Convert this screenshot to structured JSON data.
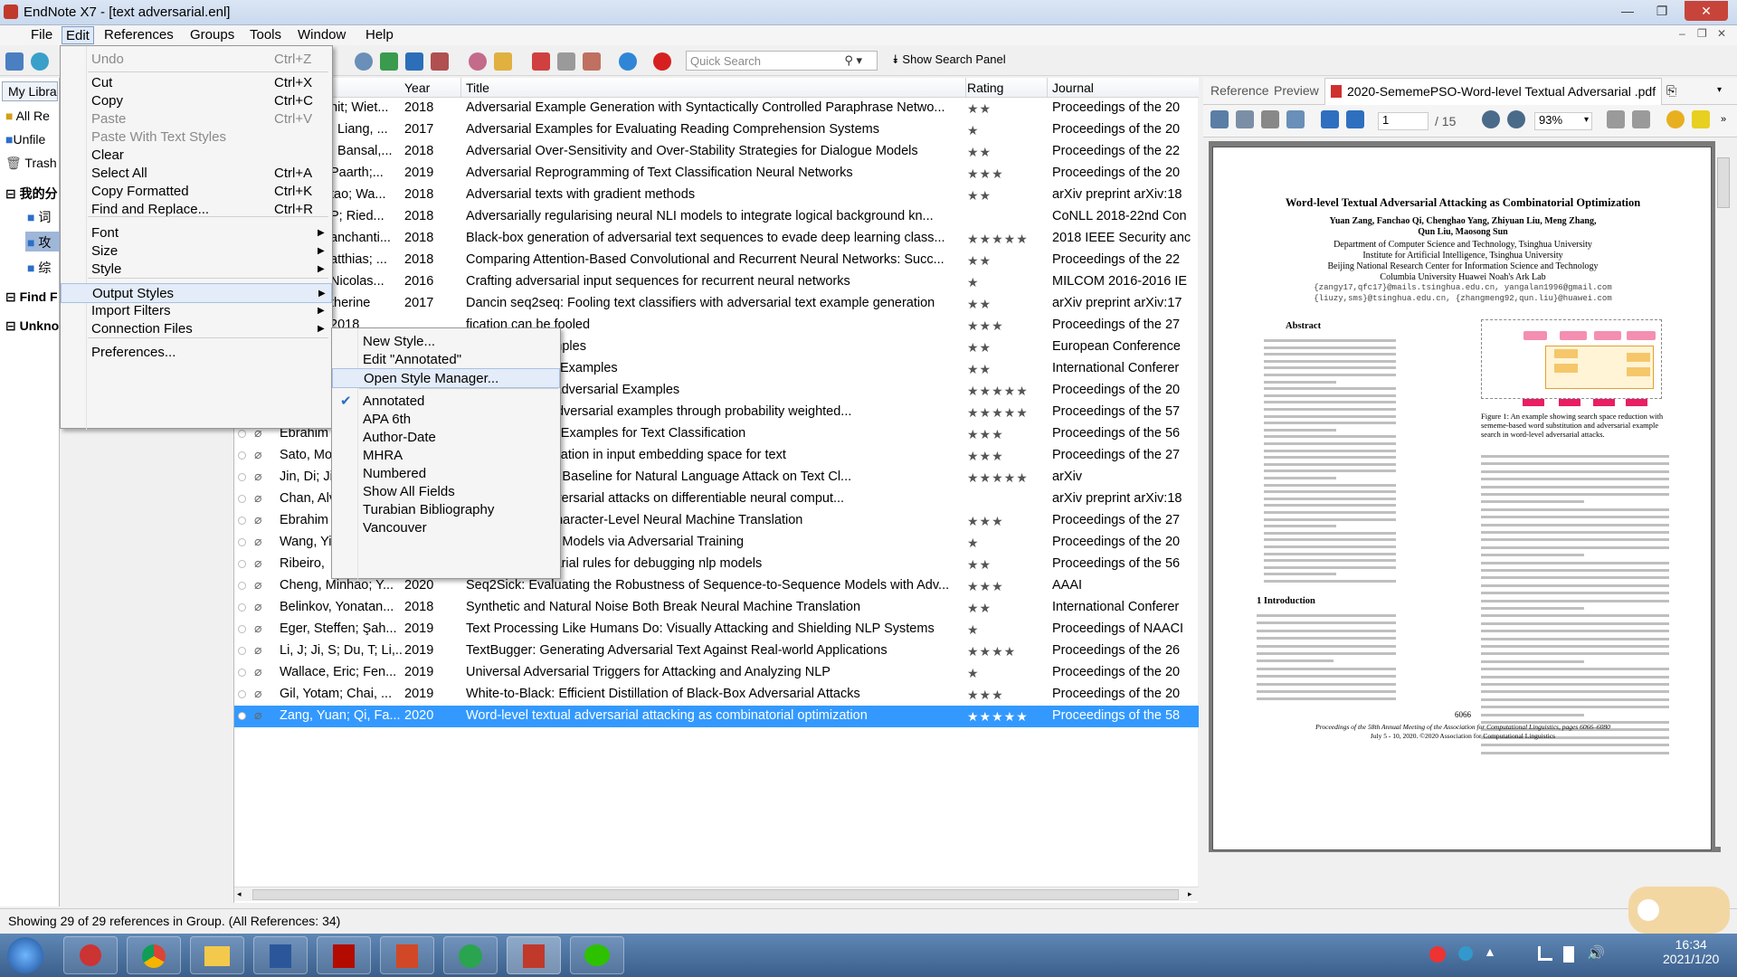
{
  "window": {
    "title": "EndNote X7 - [text adversarial.enl]"
  },
  "menubar": [
    "File",
    "Edit",
    "References",
    "Groups",
    "Tools",
    "Window",
    "Help"
  ],
  "quick_search": {
    "placeholder": "Quick Search",
    "show_panel": "Show Search Panel"
  },
  "groups": {
    "my_library": "My Libra",
    "all_refs": "All Re",
    "unfiled": "Unfile",
    "trash": "Trash",
    "group_set": "我的分",
    "sub1": "词",
    "sub2": "攻",
    "sub3": "综",
    "find": "Find F",
    "unknown": "Unkno"
  },
  "columns": {
    "year": "Year",
    "title": "Title",
    "rating": "Rating",
    "journal": "Journal"
  },
  "references": [
    {
      "author": "",
      "year": "2018",
      "title": "Adversarial Example Generation with Syntactically Controlled Paraphrase Netwo...",
      "rating": "★★",
      "journal": "Proceedings of the 20"
    },
    {
      "author": "",
      "year": "2017",
      "title": "Adversarial Examples for Evaluating Reading Comprehension Systems",
      "rating": "★",
      "journal": "Proceedings of the 20"
    },
    {
      "author": "",
      "year": "2018",
      "title": "Adversarial Over-Sensitivity and Over-Stability Strategies for Dialogue Models",
      "rating": "★★",
      "journal": "Proceedings of the 22"
    },
    {
      "author": "",
      "year": "2019",
      "title": "Adversarial Reprogramming of Text Classification Neural Networks",
      "rating": "★★★",
      "journal": "Proceedings of the 20"
    },
    {
      "author": "",
      "year": "2018",
      "title": "Adversarial texts with gradient methods",
      "rating": "★★",
      "journal": "arXiv preprint arXiv:18"
    },
    {
      "author": "",
      "year": "2018",
      "title": "Adversarially regularising neural NLI models to integrate logical background kn...",
      "rating": "",
      "journal": "CoNLL 2018-22nd Con"
    },
    {
      "author": "",
      "year": "2018",
      "title": "Black-box generation of adversarial text sequences to evade deep learning class...",
      "rating": "★★★★★",
      "journal": "2018 IEEE Security anc"
    },
    {
      "author": "",
      "year": "2018",
      "title": "Comparing Attention-Based Convolutional and Recurrent Neural Networks: Succ...",
      "rating": "★★",
      "journal": "Proceedings of the 22"
    },
    {
      "author": "",
      "year": "2016",
      "title": "Crafting adversarial input sequences for recurrent neural networks",
      "rating": "★",
      "journal": "MILCOM 2016-2016 IE"
    },
    {
      "author": "",
      "year": "2017",
      "title": "Dancin seq2seq: Fooling text classifiers with adversarial text example generation",
      "rating": "★★",
      "journal": "arXiv preprint arXiv:17"
    },
    {
      "author": "",
      "year": "",
      "title": "fication can be fooled",
      "rating": "★★★",
      "journal": "Proceedings of the 27"
    },
    {
      "author": "",
      "year": "",
      "title": "ersarial text samples",
      "rating": "★★",
      "journal": "European Conference"
    },
    {
      "author": "",
      "year": "",
      "title": "ural Adversarial Examples",
      "rating": "★★",
      "journal": "International Conferer"
    },
    {
      "author": "",
      "year": "",
      "title": "ural Language Adversarial Examples",
      "rating": "★★★★★",
      "journal": "Proceedings of the 20"
    },
    {
      "author": "",
      "year": "",
      "title": "ural language adversarial examples through probability weighted...",
      "rating": "★★★★★",
      "journal": "Proceedings of the 57"
    },
    {
      "author": "Ebrahim",
      "year": "",
      "title": "Box Adversarial Examples for Text Classification",
      "rating": "★★★",
      "journal": "Proceedings of the 56"
    },
    {
      "author": "Sato, Mo",
      "year": "",
      "title": "versarial perturbation in input embedding space for text",
      "rating": "★★★",
      "journal": "Proceedings of the 27"
    },
    {
      "author": "Jin, Di; Ji",
      "year": "",
      "title": "obust? A Strong Baseline for Natural Language Attack on Text Cl...",
      "rating": "★★★★★",
      "journal": "arXiv"
    },
    {
      "author": "Chan, Alv",
      "year": "",
      "title": "lation based adversarial attacks on differentiable neural comput...",
      "rating": "",
      "journal": "arXiv preprint arXiv:18"
    },
    {
      "author": "Ebrahim",
      "year": "",
      "title": "Examples for Character-Level Neural Machine Translation",
      "rating": "★★★",
      "journal": "Proceedings of the 27"
    },
    {
      "author": "Wang, Yi",
      "year": "",
      "title": "Comprehension Models via Adversarial Training",
      "rating": "★",
      "journal": "Proceedings of the 20"
    },
    {
      "author": "Ribeiro,",
      "year": "",
      "title": "uivalent adversarial rules for debugging nlp models",
      "rating": "★★",
      "journal": "Proceedings of the 56"
    },
    {
      "author": "Cheng, Minhao; Y...",
      "year": "2020",
      "title": "Seq2Sick: Evaluating the Robustness of Sequence-to-Sequence Models with Adv...",
      "rating": "★★★",
      "journal": "AAAI"
    },
    {
      "author": "Belinkov, Yonatan...",
      "year": "2018",
      "title": "Synthetic and Natural Noise Both Break Neural Machine Translation",
      "rating": "★★",
      "journal": "International Conferer"
    },
    {
      "author": "Eger, Steffen; Şah...",
      "year": "2019",
      "title": "Text Processing Like Humans Do: Visually Attacking and Shielding NLP Systems",
      "rating": "★",
      "journal": "Proceedings of NAACI"
    },
    {
      "author": "Li, J; Ji, S; Du, T; Li,...",
      "year": "2019",
      "title": "TextBugger: Generating Adversarial Text Against Real-world Applications",
      "rating": "★★★★",
      "journal": "Proceedings of the 26"
    },
    {
      "author": "Wallace, Eric; Fen...",
      "year": "2019",
      "title": "Universal Adversarial Triggers for Attacking and Analyzing NLP",
      "rating": "★",
      "journal": "Proceedings of the 20"
    },
    {
      "author": "Gil, Yotam; Chai, ...",
      "year": "2019",
      "title": "White-to-Black: Efficient Distillation of Black-Box Adversarial Attacks",
      "rating": "★★★",
      "journal": "Proceedings of the 20"
    },
    {
      "author": "Zang, Yuan; Qi, Fa...",
      "year": "2020",
      "title": "Word-level textual adversarial attacking as combinatorial optimization",
      "rating": "★★★★★",
      "journal": "Proceedings of the 58"
    }
  ],
  "partial_authors_top": [
    "nit; Wiet...",
    "; Liang, ...",
    "; Bansal,...",
    "Paarth;...",
    "tao; Wa...",
    "P; Ried...",
    "anchanti...",
    "atthias; ...",
    "Nicolas...",
    "therine",
    "2018"
  ],
  "edit_menu": [
    {
      "label": "Undo",
      "shortcut": "Ctrl+Z",
      "disabled": true
    },
    {
      "label": "Cut",
      "shortcut": "Ctrl+X"
    },
    {
      "label": "Copy",
      "shortcut": "Ctrl+C"
    },
    {
      "label": "Paste",
      "shortcut": "Ctrl+V",
      "disabled": true
    },
    {
      "label": "Paste With Text Styles",
      "shortcut": "",
      "disabled": true
    },
    {
      "label": "Clear",
      "shortcut": ""
    },
    {
      "label": "Select All",
      "shortcut": "Ctrl+A"
    },
    {
      "label": "Copy Formatted",
      "shortcut": "Ctrl+K"
    },
    {
      "label": "Find and Replace...",
      "shortcut": "Ctrl+R"
    },
    {
      "label": "Font",
      "shortcut": ""
    },
    {
      "label": "Size",
      "shortcut": ""
    },
    {
      "label": "Style",
      "shortcut": ""
    },
    {
      "label": "Output Styles",
      "shortcut": ""
    },
    {
      "label": "Import Filters",
      "shortcut": ""
    },
    {
      "label": "Connection Files",
      "shortcut": ""
    },
    {
      "label": "Preferences...",
      "shortcut": ""
    }
  ],
  "output_styles_menu": [
    "New Style...",
    "Edit \"Annotated\"",
    "Open Style Manager...",
    "Annotated",
    "APA 6th",
    "Author-Date",
    "MHRA",
    "Numbered",
    "Show All Fields",
    "Turabian Bibliography",
    "Vancouver"
  ],
  "checked_style": "Annotated",
  "pane": {
    "tabs": [
      "Reference",
      "Preview"
    ],
    "pdf_tab": "2020-SememePSO-Word-level Textual Adversarial .pdf",
    "page": "1",
    "total": "/ 15",
    "zoom": "93%"
  },
  "paper": {
    "title": "Word-level Textual Adversarial Attacking as Combinatorial Optimization",
    "authors": "Yuan Zang, Fanchao Qi, Chenghao Yang, Zhiyuan Liu, Meng Zhang, Qun Liu, Maosong Sun",
    "aff1": "Department of Computer Science and Technology, Tsinghua University",
    "aff2": "Institute for Artificial Intelligence, Tsinghua University",
    "aff3": "Beijing National Research Center for Information Science and Technology",
    "aff4": "Columbia University   Huawei Noah's Ark Lab",
    "email1": "{zangy17,qfc17}@mails.tsinghua.edu.cn, yangalan1996@gmail.com",
    "email2": "{liuzy,sms}@tsinghua.edu.cn, {zhangmeng92,qun.liu}@huawei.com",
    "abstract_h": "Abstract",
    "intro_h": "1   Introduction",
    "fig_caption": "Figure 1: An example showing search space reduction with sememe-based word substitution and adversarial example search in word-level adversarial attacks.",
    "page_no": "6066",
    "footer1": "Proceedings of the 58th Annual Meeting of the Association for Computational Linguistics, pages 6066–6080",
    "footer2": "July 5 - 10, 2020. ©2020 Association for Computational Linguistics"
  },
  "status": "Showing 29 of 29 references in Group. (All References: 34)",
  "clock": {
    "time": "16:34",
    "date": "2021/1/20"
  }
}
